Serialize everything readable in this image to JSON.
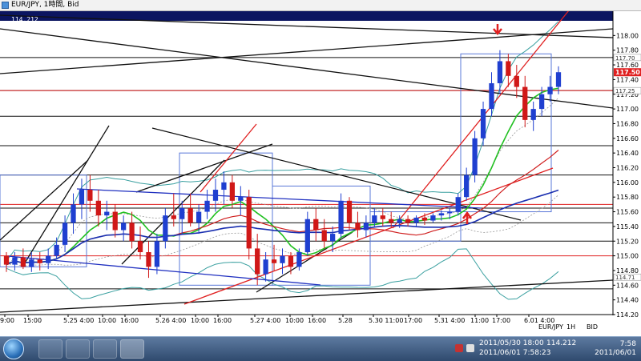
{
  "window": {
    "title": "EUR/JPY, 1時間, Bid",
    "price_tag": "114.212"
  },
  "chart_data": {
    "type": "line",
    "title": "EUR/JPY, 1時間, Bid",
    "ylim": [
      114.2,
      118.2
    ],
    "y_ticks": [
      "118.00",
      "117.80",
      "117.60",
      "117.40",
      "117.20",
      "117.00",
      "116.80",
      "116.60",
      "116.40",
      "116.20",
      "116.00",
      "115.80",
      "115.60",
      "115.40",
      "115.20",
      "115.00",
      "114.80",
      "114.60",
      "114.40",
      "114.20"
    ],
    "x_ticks": [
      "9:00",
      "15:00",
      "5.25  4:00",
      "10:00",
      "16:00",
      "5.26  4:00",
      "10:00",
      "16:00",
      "5.27  4:00",
      "10:00",
      "16:00",
      "5.28",
      "5.30 11:00",
      "17:00",
      "5.31  4:00",
      "11:00",
      "17:00",
      "6.01  4:00"
    ],
    "current_price": {
      "value": 117.5,
      "label": "117.50"
    },
    "other_price_labels": [
      {
        "value": 117.7,
        "label": "117.70"
      },
      {
        "value": 117.25,
        "label": "117.25"
      },
      {
        "value": 114.71,
        "label": "114.71"
      }
    ],
    "ohlc": [
      {
        "o": 115.0,
        "h": 115.05,
        "l": 114.78,
        "c": 114.88
      },
      {
        "o": 114.88,
        "h": 115.05,
        "l": 114.8,
        "c": 114.98
      },
      {
        "o": 114.98,
        "h": 115.1,
        "l": 114.82,
        "c": 114.85
      },
      {
        "o": 114.85,
        "h": 115.05,
        "l": 114.78,
        "c": 114.95
      },
      {
        "o": 114.95,
        "h": 115.05,
        "l": 114.8,
        "c": 114.9
      },
      {
        "o": 114.9,
        "h": 115.1,
        "l": 114.82,
        "c": 115.0
      },
      {
        "o": 115.0,
        "h": 115.25,
        "l": 114.95,
        "c": 115.15
      },
      {
        "o": 115.15,
        "h": 115.55,
        "l": 115.05,
        "c": 115.45
      },
      {
        "o": 115.45,
        "h": 115.85,
        "l": 115.3,
        "c": 115.7
      },
      {
        "o": 115.7,
        "h": 116.05,
        "l": 115.5,
        "c": 115.9
      },
      {
        "o": 115.9,
        "h": 116.1,
        "l": 115.6,
        "c": 115.75
      },
      {
        "o": 115.75,
        "h": 115.9,
        "l": 115.4,
        "c": 115.55
      },
      {
        "o": 115.55,
        "h": 115.75,
        "l": 115.35,
        "c": 115.6
      },
      {
        "o": 115.6,
        "h": 115.7,
        "l": 115.25,
        "c": 115.35
      },
      {
        "o": 115.35,
        "h": 115.55,
        "l": 115.2,
        "c": 115.45
      },
      {
        "o": 115.45,
        "h": 115.6,
        "l": 115.1,
        "c": 115.2
      },
      {
        "o": 115.2,
        "h": 115.4,
        "l": 114.95,
        "c": 115.05
      },
      {
        "o": 115.05,
        "h": 115.2,
        "l": 114.7,
        "c": 114.85
      },
      {
        "o": 114.85,
        "h": 115.3,
        "l": 114.75,
        "c": 115.2
      },
      {
        "o": 115.2,
        "h": 115.65,
        "l": 115.1,
        "c": 115.55
      },
      {
        "o": 115.55,
        "h": 115.85,
        "l": 115.4,
        "c": 115.5
      },
      {
        "o": 115.5,
        "h": 115.75,
        "l": 115.3,
        "c": 115.65
      },
      {
        "o": 115.65,
        "h": 115.85,
        "l": 115.4,
        "c": 115.45
      },
      {
        "o": 115.45,
        "h": 115.7,
        "l": 115.3,
        "c": 115.6
      },
      {
        "o": 115.6,
        "h": 115.9,
        "l": 115.5,
        "c": 115.75
      },
      {
        "o": 115.75,
        "h": 116.05,
        "l": 115.6,
        "c": 115.9
      },
      {
        "o": 115.9,
        "h": 116.15,
        "l": 115.7,
        "c": 116.0
      },
      {
        "o": 116.0,
        "h": 116.1,
        "l": 115.65,
        "c": 115.75
      },
      {
        "o": 115.75,
        "h": 115.95,
        "l": 115.55,
        "c": 115.8
      },
      {
        "o": 115.8,
        "h": 115.9,
        "l": 114.95,
        "c": 115.1
      },
      {
        "o": 115.1,
        "h": 115.3,
        "l": 114.6,
        "c": 114.75
      },
      {
        "o": 114.75,
        "h": 115.05,
        "l": 114.65,
        "c": 114.95
      },
      {
        "o": 114.95,
        "h": 115.15,
        "l": 114.8,
        "c": 114.9
      },
      {
        "o": 114.9,
        "h": 115.1,
        "l": 114.75,
        "c": 115.0
      },
      {
        "o": 115.0,
        "h": 115.05,
        "l": 114.75,
        "c": 114.85
      },
      {
        "o": 114.85,
        "h": 115.1,
        "l": 114.8,
        "c": 115.05
      },
      {
        "o": 115.05,
        "h": 115.6,
        "l": 115.0,
        "c": 115.5
      },
      {
        "o": 115.5,
        "h": 115.65,
        "l": 115.2,
        "c": 115.35
      },
      {
        "o": 115.35,
        "h": 115.5,
        "l": 115.1,
        "c": 115.2
      },
      {
        "o": 115.2,
        "h": 115.4,
        "l": 115.05,
        "c": 115.3
      },
      {
        "o": 115.3,
        "h": 115.85,
        "l": 115.25,
        "c": 115.75
      },
      {
        "o": 115.75,
        "h": 115.8,
        "l": 115.35,
        "c": 115.45
      },
      {
        "o": 115.45,
        "h": 115.6,
        "l": 115.25,
        "c": 115.35
      },
      {
        "o": 115.35,
        "h": 115.55,
        "l": 115.25,
        "c": 115.45
      },
      {
        "o": 115.45,
        "h": 115.65,
        "l": 115.4,
        "c": 115.55
      },
      {
        "o": 115.55,
        "h": 115.65,
        "l": 115.4,
        "c": 115.5
      },
      {
        "o": 115.5,
        "h": 115.6,
        "l": 115.38,
        "c": 115.45
      },
      {
        "o": 115.45,
        "h": 115.55,
        "l": 115.38,
        "c": 115.5
      },
      {
        "o": 115.5,
        "h": 115.55,
        "l": 115.4,
        "c": 115.45
      },
      {
        "o": 115.45,
        "h": 115.55,
        "l": 115.4,
        "c": 115.52
      },
      {
        "o": 115.52,
        "h": 115.58,
        "l": 115.42,
        "c": 115.48
      },
      {
        "o": 115.48,
        "h": 115.58,
        "l": 115.45,
        "c": 115.55
      },
      {
        "o": 115.55,
        "h": 115.62,
        "l": 115.48,
        "c": 115.58
      },
      {
        "o": 115.58,
        "h": 115.65,
        "l": 115.5,
        "c": 115.6
      },
      {
        "o": 115.6,
        "h": 115.85,
        "l": 115.55,
        "c": 115.8
      },
      {
        "o": 115.8,
        "h": 116.2,
        "l": 115.75,
        "c": 116.1
      },
      {
        "o": 116.1,
        "h": 116.7,
        "l": 116.0,
        "c": 116.6
      },
      {
        "o": 116.6,
        "h": 117.1,
        "l": 116.5,
        "c": 117.0
      },
      {
        "o": 117.0,
        "h": 117.5,
        "l": 116.9,
        "c": 117.35
      },
      {
        "o": 117.35,
        "h": 117.8,
        "l": 117.2,
        "c": 117.65
      },
      {
        "o": 117.65,
        "h": 117.75,
        "l": 117.3,
        "c": 117.45
      },
      {
        "o": 117.45,
        "h": 117.6,
        "l": 117.15,
        "c": 117.3
      },
      {
        "o": 117.3,
        "h": 117.45,
        "l": 116.75,
        "c": 116.85
      },
      {
        "o": 116.85,
        "h": 117.1,
        "l": 116.7,
        "c": 117.0
      },
      {
        "o": 117.0,
        "h": 117.3,
        "l": 116.9,
        "c": 117.2
      },
      {
        "o": 117.2,
        "h": 117.45,
        "l": 117.1,
        "c": 117.3
      },
      {
        "o": 117.3,
        "h": 117.58,
        "l": 117.2,
        "c": 117.5
      }
    ]
  },
  "status_bar": {
    "pair": "EUR/JPY",
    "timeframe": "1H",
    "side": "BID"
  },
  "taskbar": {
    "info_time": "2011/05/30 18:00",
    "info_price": "114.212",
    "info_time2": "2011/06/01 7:58:23",
    "clock_time": "7:58",
    "clock_date": "2011/06/01"
  },
  "colors": {
    "up": "#1f3fd0",
    "down": "#d01818",
    "ma_green": "#21c021",
    "ma_blue": "#1a2fb0",
    "ma_red": "#d02020",
    "band": "#3aa0a0",
    "trend_red": "#e02020",
    "trend_black": "#111111",
    "trend_blue": "#2030c0",
    "box": "#5a78d8"
  }
}
